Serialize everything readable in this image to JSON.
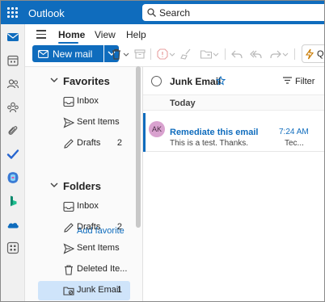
{
  "app": {
    "title": "Outlook"
  },
  "search": {
    "placeholder": "Search"
  },
  "ribbon": {
    "tabs": [
      {
        "label": "Home",
        "active": true
      },
      {
        "label": "View",
        "active": false
      },
      {
        "label": "Help",
        "active": false
      }
    ],
    "new_mail_label": "New mail",
    "quick_label": "Qu"
  },
  "folders": {
    "favorites_header": "Favorites",
    "favorites": [
      {
        "label": "Inbox",
        "icon": "inbox-icon",
        "count": ""
      },
      {
        "label": "Sent Items",
        "icon": "send-icon",
        "count": ""
      },
      {
        "label": "Drafts",
        "icon": "pencil-icon",
        "count": "2"
      }
    ],
    "add_favorite": "Add favorite",
    "folders_header": "Folders",
    "items": [
      {
        "label": "Inbox",
        "icon": "inbox-icon",
        "count": ""
      },
      {
        "label": "Drafts",
        "icon": "pencil-icon",
        "count": "2"
      },
      {
        "label": "Sent Items",
        "icon": "send-icon",
        "count": ""
      },
      {
        "label": "Deleted Ite...",
        "icon": "trash-icon",
        "count": ""
      },
      {
        "label": "Junk Email",
        "icon": "junk-folder-icon",
        "count": "1",
        "selected": true
      }
    ]
  },
  "message_list": {
    "title": "Junk Email",
    "filter_label": "Filter",
    "day_header": "Today",
    "messages": [
      {
        "avatar_initials": "AK",
        "subject": "Remediate this email",
        "time": "7:24 AM",
        "preview": "This is a test. Thanks.",
        "preview_right": "Tec..."
      }
    ]
  },
  "colors": {
    "brand": "#0f6cbd",
    "selected_folder": "#cfe4fa",
    "avatar": "#d9a2cf"
  }
}
